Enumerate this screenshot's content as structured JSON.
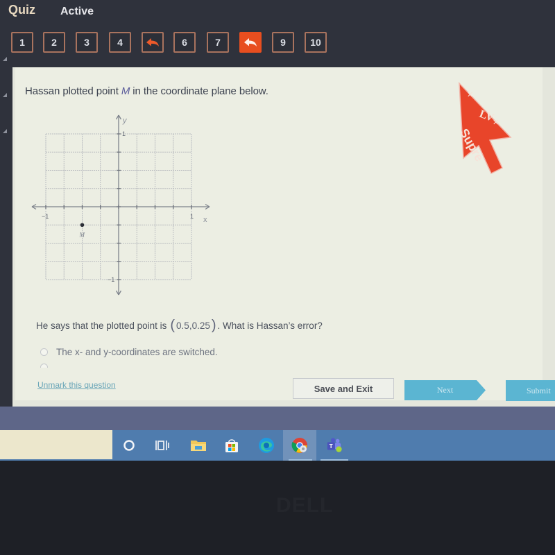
{
  "header": {
    "brand": "Quiz",
    "status": "Active"
  },
  "question_nav": [
    {
      "label": "1",
      "state": "default"
    },
    {
      "label": "2",
      "state": "default"
    },
    {
      "label": "3",
      "state": "default"
    },
    {
      "label": "4",
      "state": "default"
    },
    {
      "label": "",
      "state": "flagged",
      "icon": "flag-return-icon"
    },
    {
      "label": "6",
      "state": "default"
    },
    {
      "label": "7",
      "state": "default"
    },
    {
      "label": "",
      "state": "current-flagged",
      "icon": "flag-return-icon"
    },
    {
      "label": "9",
      "state": "default"
    },
    {
      "label": "10",
      "state": "default"
    }
  ],
  "question": {
    "intro_prefix": "Hassan plotted point ",
    "intro_var": "M",
    "intro_suffix": " in the coordinate plane below.",
    "prompt_prefix": "He says that the plotted point is",
    "prompt_coord": "0.5,0.25",
    "prompt_suffix": ". What is Hassan’s error?",
    "options": [
      {
        "label": "The x- and y-coordinates are switched.",
        "selected": false
      }
    ]
  },
  "graph": {
    "x_label": "x",
    "y_label": "y",
    "tick_labels": {
      "x_min": "−1",
      "x_max": "1",
      "y_min": "−1",
      "y_max": "1"
    },
    "point_label": "M"
  },
  "chart_data": {
    "type": "scatter",
    "title": "",
    "xlabel": "x",
    "ylabel": "y",
    "xlim": [
      -1,
      1
    ],
    "ylim": [
      -1,
      1
    ],
    "grid": true,
    "grid_step": 0.25,
    "points": [
      {
        "name": "M",
        "x": -0.5,
        "y": -0.25
      }
    ]
  },
  "footer": {
    "unmark_label": "Unmark this question",
    "save_label": "Save and Exit",
    "next_label": "Next",
    "submit_label": "Submit"
  },
  "taskbar": {
    "icons": [
      "cortana-icon",
      "task-view-icon",
      "file-explorer-icon",
      "microsoft-store-icon",
      "edge-icon",
      "chrome-icon",
      "teams-icon"
    ],
    "active": "chrome-icon"
  },
  "colors": {
    "accent_flag": "#e84e1f",
    "button_blue": "#5bb5d2",
    "link": "#6aa6b8"
  },
  "bezel": {
    "logo": "DELL"
  }
}
